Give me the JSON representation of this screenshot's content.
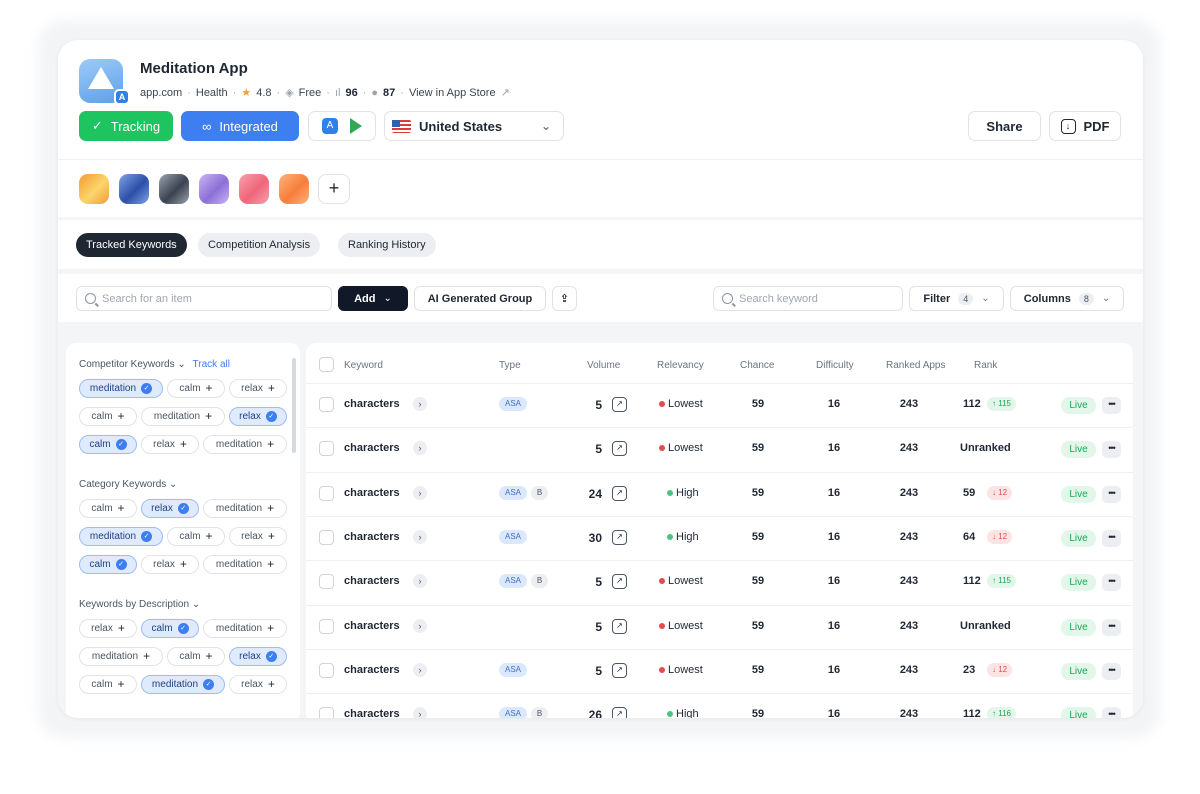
{
  "app": {
    "name": "Meditation App",
    "domain": "app.com",
    "category": "Health",
    "rating": "4.8",
    "price": "Free",
    "stat1": "96",
    "stat2": "87",
    "store_link": "View in App Store"
  },
  "actions": {
    "tracking": "Tracking",
    "integrated": "Integrated",
    "country": "United States",
    "share": "Share",
    "pdf": "PDF"
  },
  "competitors": [
    {
      "name": "competitor-1",
      "color_a": "#fbd56a",
      "color_b": "#f39a33"
    },
    {
      "name": "competitor-2",
      "color_a": "#2d4fa8",
      "color_b": "#7ea3e6"
    },
    {
      "name": "competitor-3",
      "color_a": "#3b4250",
      "color_b": "#9aa3ae"
    },
    {
      "name": "competitor-4",
      "color_a": "#8c6fd6",
      "color_b": "#c9b6f3"
    },
    {
      "name": "competitor-5",
      "color_a": "#f0657a",
      "color_b": "#f7a1ad"
    },
    {
      "name": "competitor-6",
      "color_a": "#f77d3a",
      "color_b": "#fcb47c"
    }
  ],
  "tabs": [
    "Tracked Keywords",
    "Competition Analysis",
    "Ranking History"
  ],
  "toolbar": {
    "search_placeholder": "Search for an item",
    "add": "Add",
    "ai_group": "AI Generated Group",
    "keyword_placeholder": "Search keyword",
    "filter": "Filter",
    "filter_count": "4",
    "columns": "Columns",
    "columns_count": "8"
  },
  "sidebar": {
    "competitor": {
      "title": "Competitor Keywords",
      "track_all": "Track all",
      "rows": [
        [
          {
            "t": "meditation",
            "s": true
          },
          {
            "t": "calm",
            "s": false
          },
          {
            "t": "relax",
            "s": false
          }
        ],
        [
          {
            "t": "calm",
            "s": false
          },
          {
            "t": "meditation",
            "s": false
          },
          {
            "t": "relax",
            "s": true
          }
        ],
        [
          {
            "t": "calm",
            "s": true
          },
          {
            "t": "relax",
            "s": false
          },
          {
            "t": "meditation",
            "s": false
          }
        ]
      ]
    },
    "category": {
      "title": "Category Keywords",
      "rows": [
        [
          {
            "t": "calm",
            "s": false
          },
          {
            "t": "relax",
            "s": true
          },
          {
            "t": "meditation",
            "s": false
          }
        ],
        [
          {
            "t": "meditation",
            "s": true
          },
          {
            "t": "calm",
            "s": false
          },
          {
            "t": "relax",
            "s": false
          }
        ],
        [
          {
            "t": "calm",
            "s": true
          },
          {
            "t": "relax",
            "s": false
          },
          {
            "t": "meditation",
            "s": false
          }
        ]
      ]
    },
    "description": {
      "title": "Keywords by Description",
      "rows": [
        [
          {
            "t": "relax",
            "s": false
          },
          {
            "t": "calm",
            "s": true
          },
          {
            "t": "meditation",
            "s": false
          }
        ],
        [
          {
            "t": "meditation",
            "s": false
          },
          {
            "t": "calm",
            "s": false
          },
          {
            "t": "relax",
            "s": true
          }
        ],
        [
          {
            "t": "calm",
            "s": false
          },
          {
            "t": "meditation",
            "s": true
          },
          {
            "t": "relax",
            "s": false
          }
        ]
      ]
    }
  },
  "table": {
    "headers": [
      "Keyword",
      "Type",
      "Volume",
      "Relevancy",
      "Chance",
      "Difficulty",
      "Ranked Apps",
      "Rank"
    ],
    "rows": [
      {
        "keyword": "characters",
        "asa": true,
        "b": false,
        "volume": "5",
        "relevancy": "Lowest",
        "chance": "59",
        "difficulty": "16",
        "ranked_apps": "243",
        "rank": "112",
        "change": "↑ 115",
        "dir": "up",
        "status": "Live"
      },
      {
        "keyword": "characters",
        "asa": false,
        "b": false,
        "volume": "5",
        "relevancy": "Lowest",
        "chance": "59",
        "difficulty": "16",
        "ranked_apps": "243",
        "rank": "Unranked",
        "change": "",
        "dir": "",
        "status": "Live"
      },
      {
        "keyword": "characters",
        "asa": true,
        "b": true,
        "volume": "24",
        "relevancy": "High",
        "chance": "59",
        "difficulty": "16",
        "ranked_apps": "243",
        "rank": "59",
        "change": "↓ 12",
        "dir": "down",
        "status": "Live"
      },
      {
        "keyword": "characters",
        "asa": true,
        "b": false,
        "volume": "30",
        "relevancy": "High",
        "chance": "59",
        "difficulty": "16",
        "ranked_apps": "243",
        "rank": "64",
        "change": "↓ 12",
        "dir": "down",
        "status": "Live"
      },
      {
        "keyword": "characters",
        "asa": true,
        "b": true,
        "volume": "5",
        "relevancy": "Lowest",
        "chance": "59",
        "difficulty": "16",
        "ranked_apps": "243",
        "rank": "112",
        "change": "↑ 115",
        "dir": "up",
        "status": "Live"
      },
      {
        "keyword": "characters",
        "asa": false,
        "b": false,
        "volume": "5",
        "relevancy": "Lowest",
        "chance": "59",
        "difficulty": "16",
        "ranked_apps": "243",
        "rank": "Unranked",
        "change": "",
        "dir": "",
        "status": "Live"
      },
      {
        "keyword": "characters",
        "asa": true,
        "b": false,
        "volume": "5",
        "relevancy": "Lowest",
        "chance": "59",
        "difficulty": "16",
        "ranked_apps": "243",
        "rank": "23",
        "change": "↓ 12",
        "dir": "down",
        "status": "Live"
      },
      {
        "keyword": "characters",
        "asa": true,
        "b": true,
        "volume": "26",
        "relevancy": "High",
        "chance": "59",
        "difficulty": "16",
        "ranked_apps": "243",
        "rank": "112",
        "change": "↑ 116",
        "dir": "up",
        "status": "Live"
      }
    ]
  },
  "colors": {
    "green": "#1ec45f",
    "blue": "#3d7ef1",
    "red": "#e14d4d",
    "highGreen": "#4cc285"
  }
}
